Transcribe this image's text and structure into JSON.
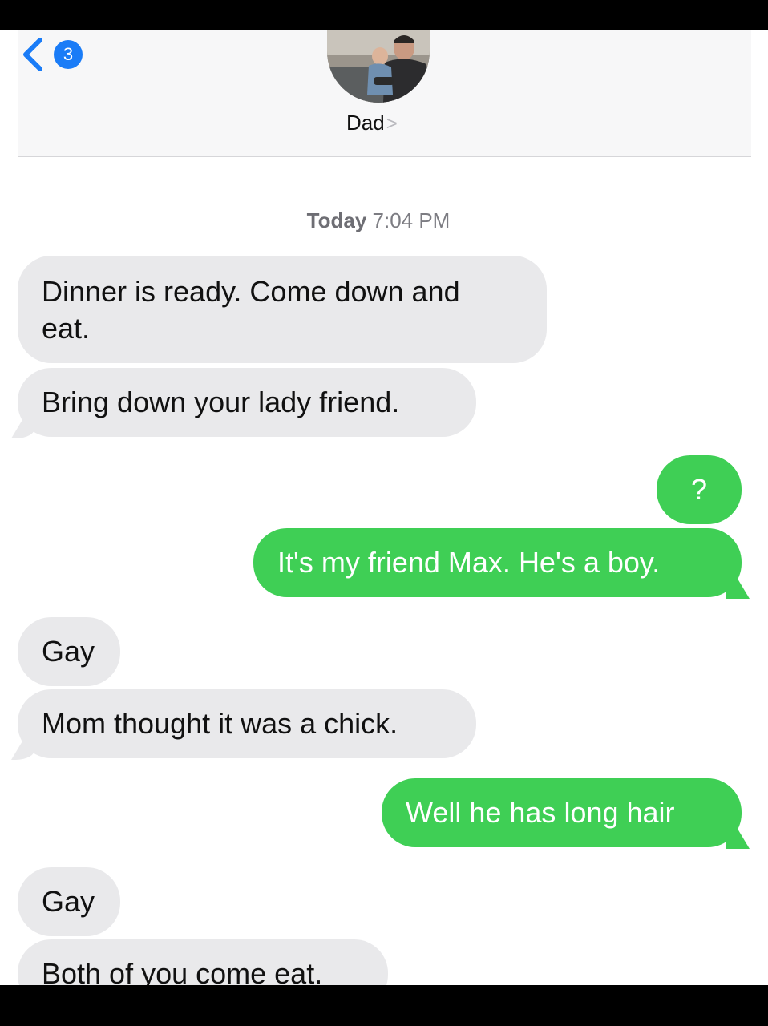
{
  "header": {
    "unread_count": "3",
    "contact_name": "Dad",
    "contact_chevron": ">"
  },
  "timestamp": {
    "day": "Today",
    "time": "7:04 PM"
  },
  "messages": [
    {
      "direction": "received",
      "line1": "Dinner is ready. Come down and",
      "line2": "eat."
    },
    {
      "direction": "received",
      "line1": "Bring down your lady friend."
    },
    {
      "direction": "sent",
      "line1": "?"
    },
    {
      "direction": "sent",
      "line1": "It's my friend Max. He's a boy."
    },
    {
      "direction": "received",
      "line1": "Gay"
    },
    {
      "direction": "received",
      "line1": "Mom thought it was a chick."
    },
    {
      "direction": "sent",
      "line1": "Well he has long hair"
    },
    {
      "direction": "received",
      "line1": "Gay"
    },
    {
      "direction": "received",
      "line1": "Both of you come eat."
    }
  ],
  "colors": {
    "sent_bubble": "#3fcf55",
    "received_bubble": "#e9e9eb",
    "badge": "#1a7cf7"
  }
}
